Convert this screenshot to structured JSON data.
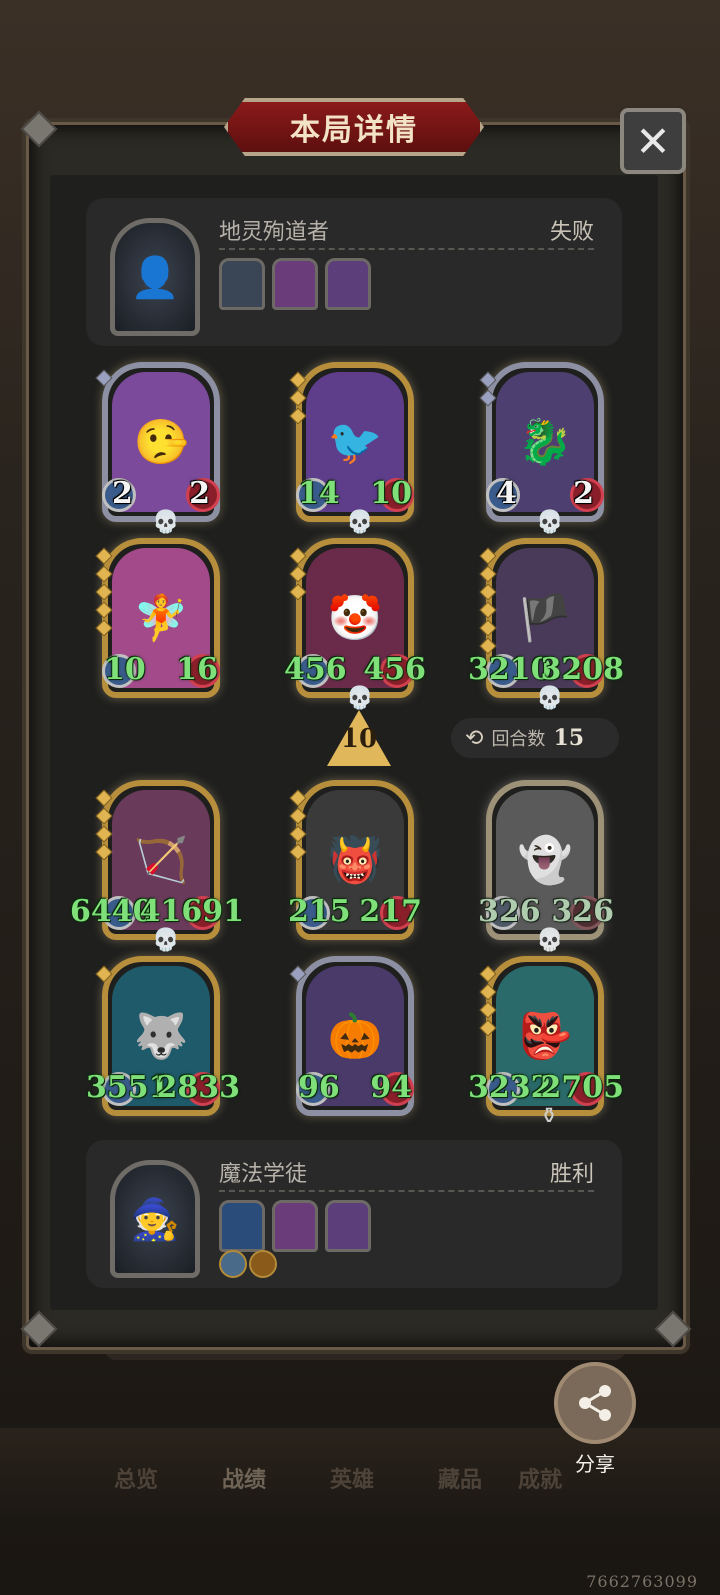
{
  "dialog": {
    "title": "本局详情",
    "close_icon": "close-icon"
  },
  "opponent": {
    "name": "地灵殉道者",
    "result": "失败",
    "avatar_icon": "hooded-figure-icon",
    "relics": [
      {
        "icon": "armor-relic-icon",
        "color": "#3a4656"
      },
      {
        "icon": "brain-jar-relic-icon",
        "color": "#6a3c7a"
      },
      {
        "icon": "treasure-chest-relic-icon",
        "color": "#5c3e7a"
      }
    ],
    "minions": [
      {
        "name": "pinocchio-card",
        "attack": "2",
        "health": "2",
        "frame": "silver",
        "art": "#7b4a9a",
        "symbol": "🤥",
        "gems": 0
      },
      {
        "name": "pelican-card",
        "attack": "14",
        "health": "10",
        "frame": "gold",
        "art": "#5e3d8a",
        "symbol": "🐦",
        "gems": 3
      },
      {
        "name": "shadow-dragon-card",
        "attack": "4",
        "health": "2",
        "frame": "silver",
        "art": "#4d4070",
        "symbol": "🐉",
        "gems": 0
      },
      {
        "name": "fairy-card",
        "attack": "10",
        "health": "16",
        "frame": "gold",
        "art": "#a24a8a",
        "symbol": "🧚",
        "gems": 5
      },
      {
        "name": "jester-card",
        "attack": "456",
        "health": "456",
        "frame": "gold",
        "art": "#6a2a4a",
        "symbol": "🤡",
        "gems": 3
      },
      {
        "name": "pirate-card",
        "attack": "3210",
        "health": "3208",
        "frame": "gold",
        "art": "#4a3a5a",
        "symbol": "🏴",
        "gems": 6
      }
    ]
  },
  "battle": {
    "level": "10",
    "rounds_label": "回合数",
    "rounds_value": "15"
  },
  "player": {
    "name": "魔法学徒",
    "result": "胜利",
    "avatar_icon": "witch-apprentice-icon",
    "relics": [
      {
        "icon": "crystal-ball-relic-icon",
        "color": "#2a4c7a"
      },
      {
        "icon": "brain-jar-relic-icon",
        "color": "#6a3c7a"
      },
      {
        "icon": "treasure-chest-relic-icon",
        "color": "#5c3e7a"
      }
    ],
    "badges": [
      {
        "icon": "sword-badge-icon",
        "color": "#4a6a8a"
      },
      {
        "icon": "coin-badge-icon",
        "color": "#8a5a1a"
      }
    ],
    "minions": [
      {
        "name": "archer-card",
        "attack": "6440",
        "health": "41691",
        "frame": "gold",
        "art": "#6a3a5a",
        "symbol": "🏹",
        "gems": 4
      },
      {
        "name": "monster-card",
        "attack": "215",
        "health": "217",
        "frame": "gold",
        "art": "#3a3a3a",
        "symbol": "👹",
        "gems": 4
      },
      {
        "name": "ghost-lady-card",
        "attack": "326",
        "health": "326",
        "frame": "gold",
        "art": "#5a5a5a",
        "symbol": "👻",
        "gems": 0
      },
      {
        "name": "spirit-wolf-card",
        "attack": "3551",
        "health": "2833",
        "frame": "gold",
        "art": "#1e5a6a",
        "symbol": "🐺",
        "gems": 1
      },
      {
        "name": "pumpkin-card",
        "attack": "96",
        "health": "94",
        "frame": "silver",
        "art": "#4a3a6a",
        "symbol": "🎃",
        "gems": 0
      },
      {
        "name": "specter-card",
        "attack": "3232",
        "health": "2705",
        "frame": "gold",
        "art": "#2a6a6a",
        "symbol": "👺",
        "gems": 4
      }
    ]
  },
  "share": {
    "label": "分享",
    "icon": "share-icon"
  },
  "nav": {
    "tabs": [
      {
        "label": "总览"
      },
      {
        "label": "战绩"
      },
      {
        "label": "英雄"
      },
      {
        "label": "藏品"
      },
      {
        "label": "成就"
      }
    ]
  },
  "uid": "7662763099"
}
